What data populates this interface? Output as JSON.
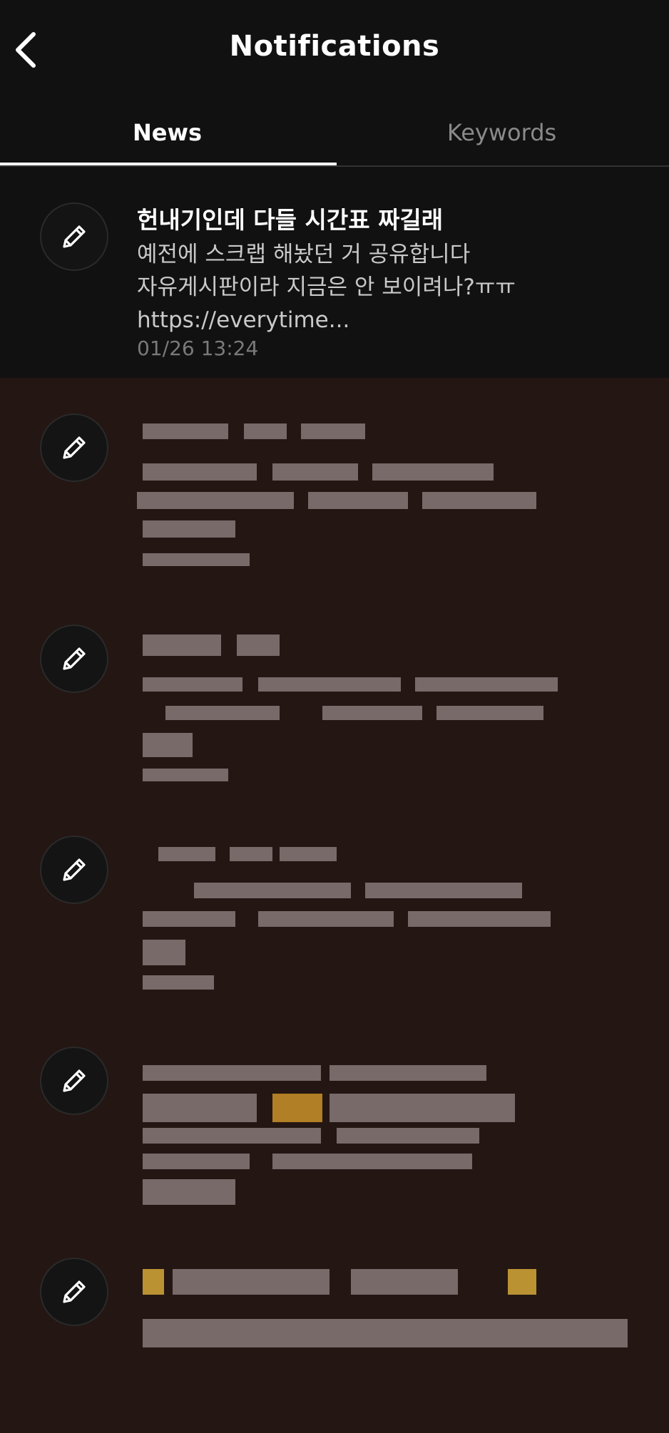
{
  "header": {
    "title": "Notifications",
    "back_icon": "chevron-left-icon"
  },
  "tabs": [
    {
      "label": "News",
      "active": true
    },
    {
      "label": "Keywords",
      "active": false
    }
  ],
  "notifications": [
    {
      "icon": "pencil-icon",
      "title": "헌내기인데 다들 시간표 짜길래",
      "body_lines": [
        "예전에 스크랩 해놨던 거 공유합니다",
        "자유게시판이라 지금은 안 보이려나?ㅠㅠ",
        "https://everytime..."
      ],
      "time": "01/26 13:24",
      "read": true
    },
    {
      "icon": "pencil-icon",
      "read": false
    },
    {
      "icon": "pencil-icon",
      "read": false
    },
    {
      "icon": "pencil-icon",
      "read": false
    },
    {
      "icon": "pencil-icon",
      "read": false
    },
    {
      "icon": "pencil-icon",
      "read": false
    }
  ],
  "colors": {
    "header_bg": "#111111",
    "unread_bg": "#241613",
    "accent": "#ffffff",
    "muted": "#8a8a8a"
  }
}
